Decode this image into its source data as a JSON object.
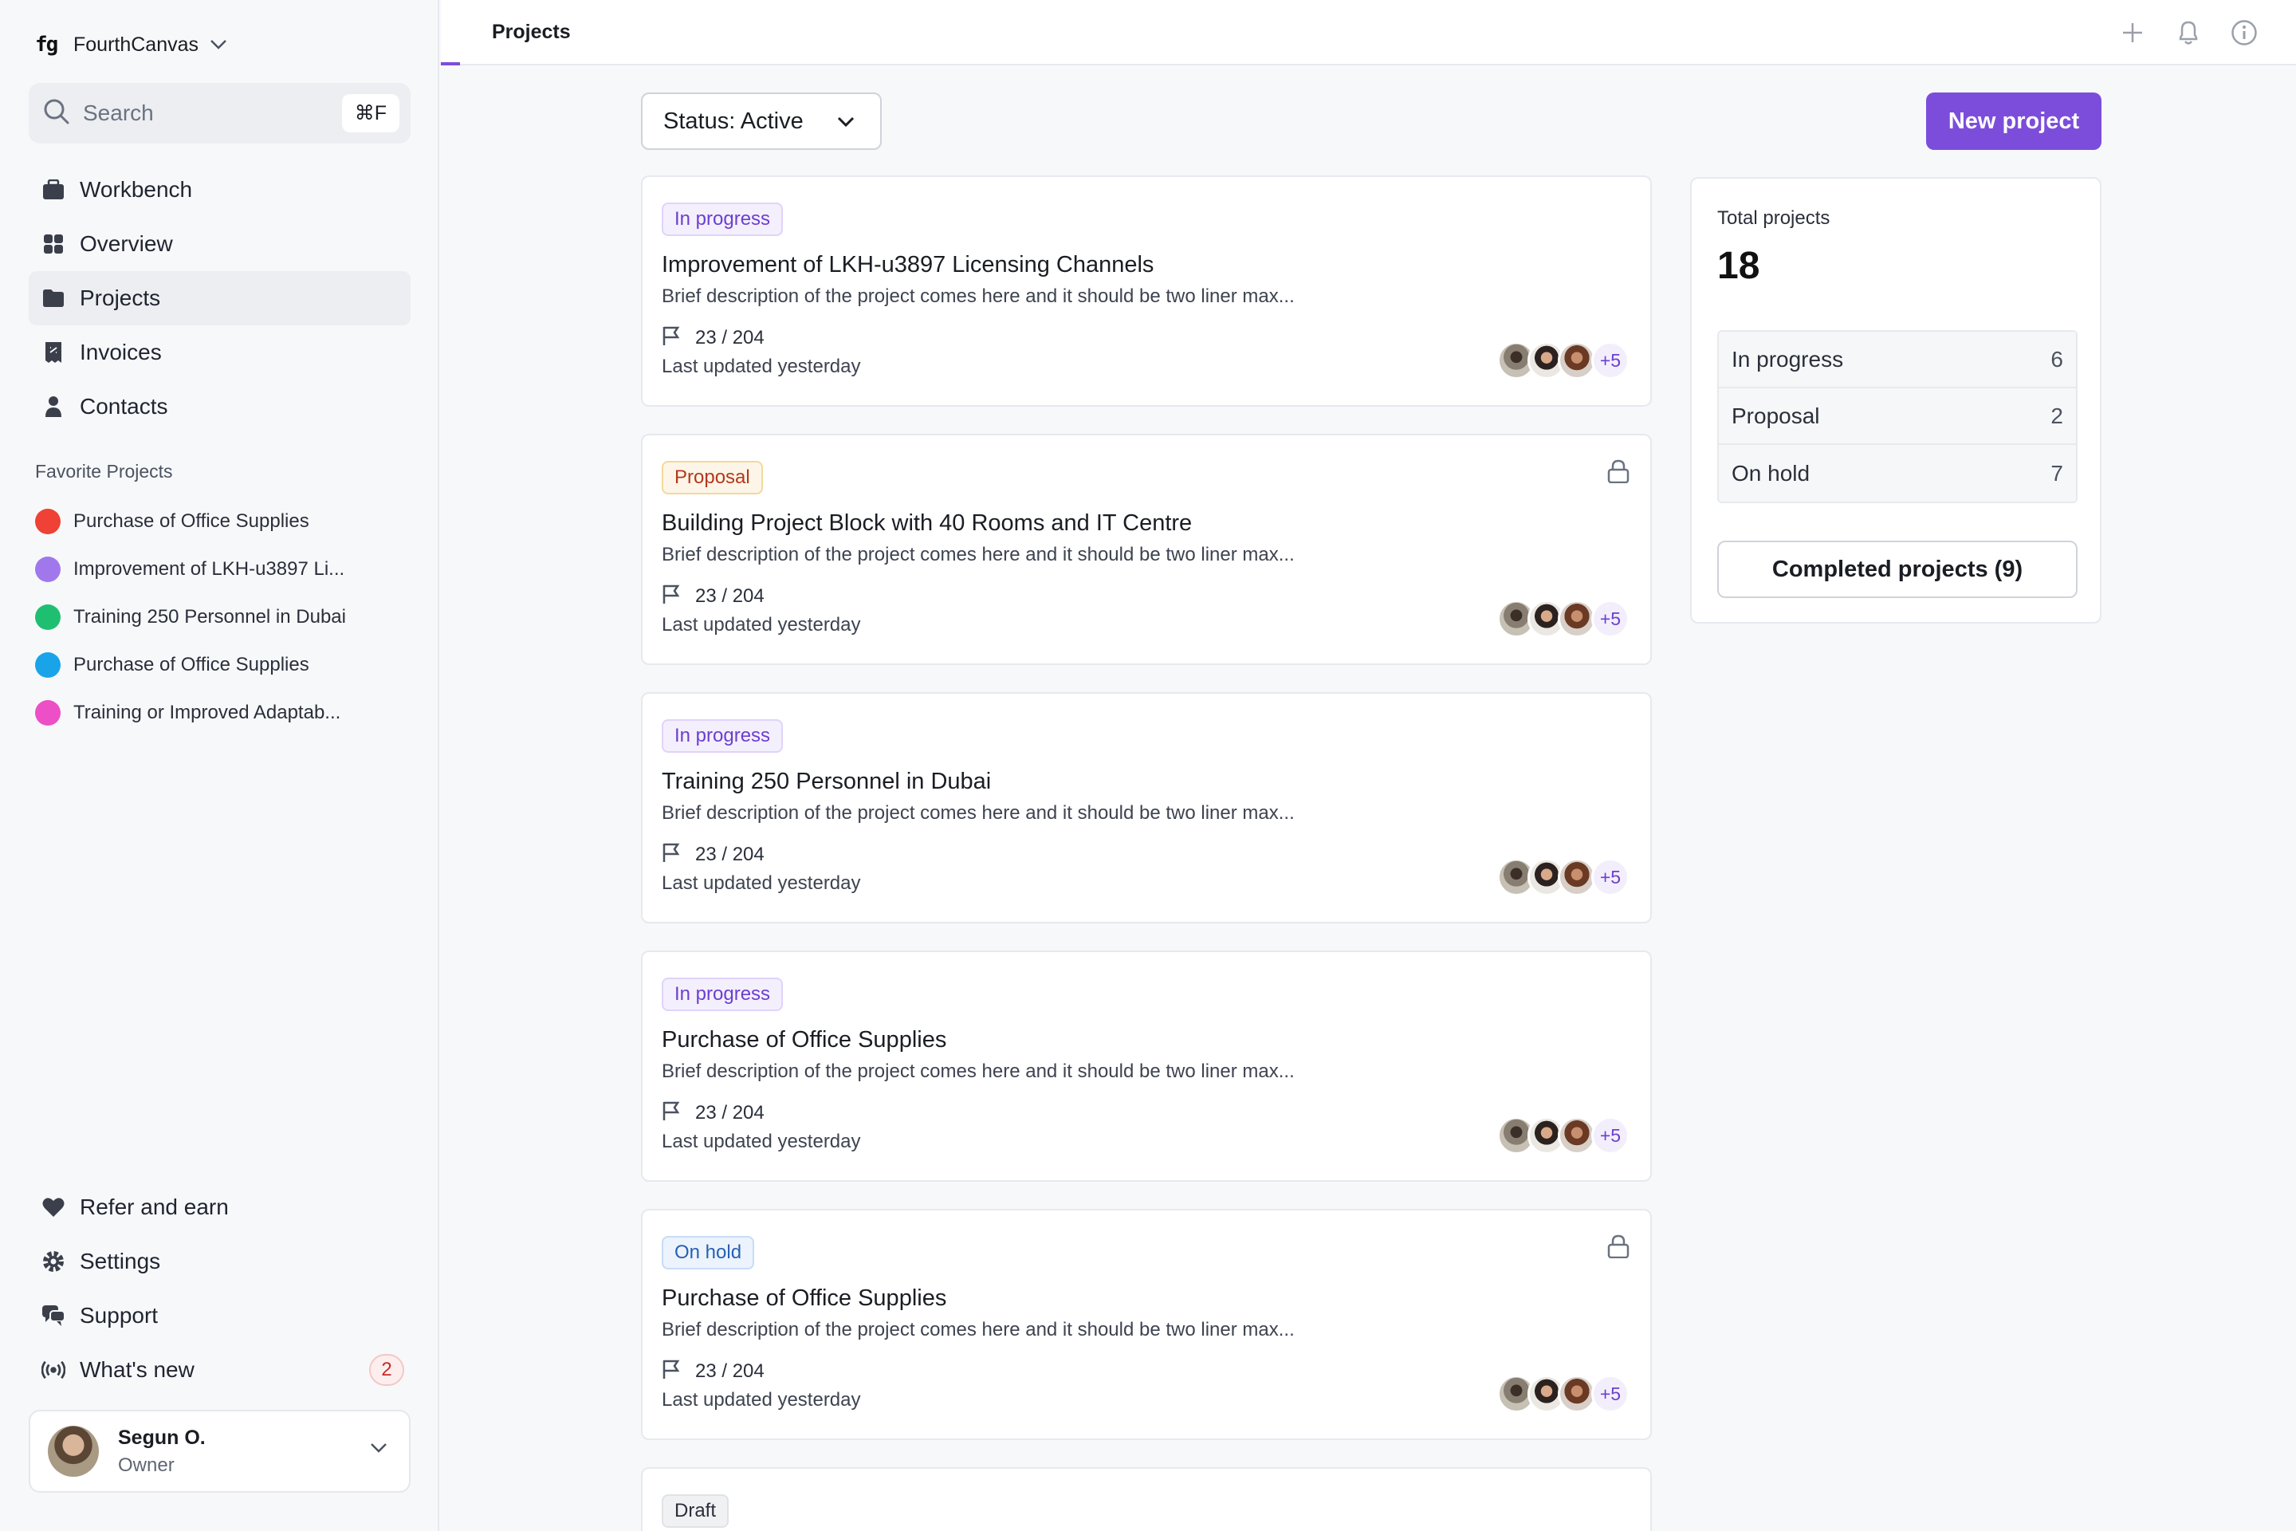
{
  "app": {
    "logo_text": "fg",
    "workspace_name": "FourthCanvas"
  },
  "search": {
    "placeholder": "Search",
    "shortcut": "⌘F"
  },
  "nav": {
    "items": [
      {
        "label": "Workbench",
        "icon": "briefcase-icon"
      },
      {
        "label": "Overview",
        "icon": "grid-icon"
      },
      {
        "label": "Projects",
        "icon": "folder-icon",
        "active": true
      },
      {
        "label": "Invoices",
        "icon": "invoice-icon"
      },
      {
        "label": "Contacts",
        "icon": "person-icon"
      }
    ]
  },
  "favorites": {
    "title": "Favorite Projects",
    "items": [
      {
        "label": "Purchase of Office Supplies",
        "color": "#ef4135"
      },
      {
        "label": "Improvement of LKH-u3897 Li...",
        "color": "#a078ec"
      },
      {
        "label": "Training 250 Personnel in Dubai",
        "color": "#1fbf72"
      },
      {
        "label": "Purchase of Office Supplies",
        "color": "#19a4ea"
      },
      {
        "label": "Training or Improved Adaptab...",
        "color": "#ec4fc6"
      }
    ]
  },
  "bottom_nav": {
    "items": [
      {
        "label": "Refer and earn",
        "icon": "heart-icon"
      },
      {
        "label": "Settings",
        "icon": "gear-icon"
      },
      {
        "label": "Support",
        "icon": "chat-icon"
      },
      {
        "label": "What's new",
        "icon": "broadcast-icon",
        "badge": "2"
      }
    ]
  },
  "user": {
    "name": "Segun O.",
    "role": "Owner"
  },
  "topbar": {
    "tab": "Projects"
  },
  "filter": {
    "label": "Status: Active"
  },
  "new_project_label": "New project",
  "projects": [
    {
      "status": "In progress",
      "status_type": "progress",
      "locked": false,
      "title": "Improvement of LKH-u3897 Licensing Channels",
      "description": "Brief description of the project comes here and it should be two liner max...",
      "count": "23 / 204",
      "updated": "Last updated yesterday",
      "more": "+5"
    },
    {
      "status": "Proposal",
      "status_type": "proposal",
      "locked": true,
      "title": "Building Project Block with 40 Rooms and IT Centre",
      "description": "Brief description of the project comes here and it should be two liner max...",
      "count": "23 / 204",
      "updated": "Last updated yesterday",
      "more": "+5"
    },
    {
      "status": "In progress",
      "status_type": "progress",
      "locked": false,
      "title": "Training 250 Personnel in Dubai",
      "description": "Brief description of the project comes here and it should be two liner max...",
      "count": "23 / 204",
      "updated": "Last updated yesterday",
      "more": "+5"
    },
    {
      "status": "In progress",
      "status_type": "progress",
      "locked": false,
      "title": "Purchase of Office Supplies",
      "description": "Brief description of the project comes here and it should be two liner max...",
      "count": "23 / 204",
      "updated": "Last updated yesterday",
      "more": "+5"
    },
    {
      "status": "On hold",
      "status_type": "hold",
      "locked": true,
      "title": "Purchase of Office Supplies",
      "description": "Brief description of the project comes here and it should be two liner max...",
      "count": "23 / 204",
      "updated": "Last updated yesterday",
      "more": "+5"
    }
  ],
  "partial_project": {
    "status": "Draft"
  },
  "summary": {
    "title": "Total projects",
    "total": "18",
    "rows": [
      {
        "label": "In progress",
        "value": "6"
      },
      {
        "label": "Proposal",
        "value": "2"
      },
      {
        "label": "On hold",
        "value": "7"
      }
    ],
    "completed_label": "Completed projects (9)"
  }
}
